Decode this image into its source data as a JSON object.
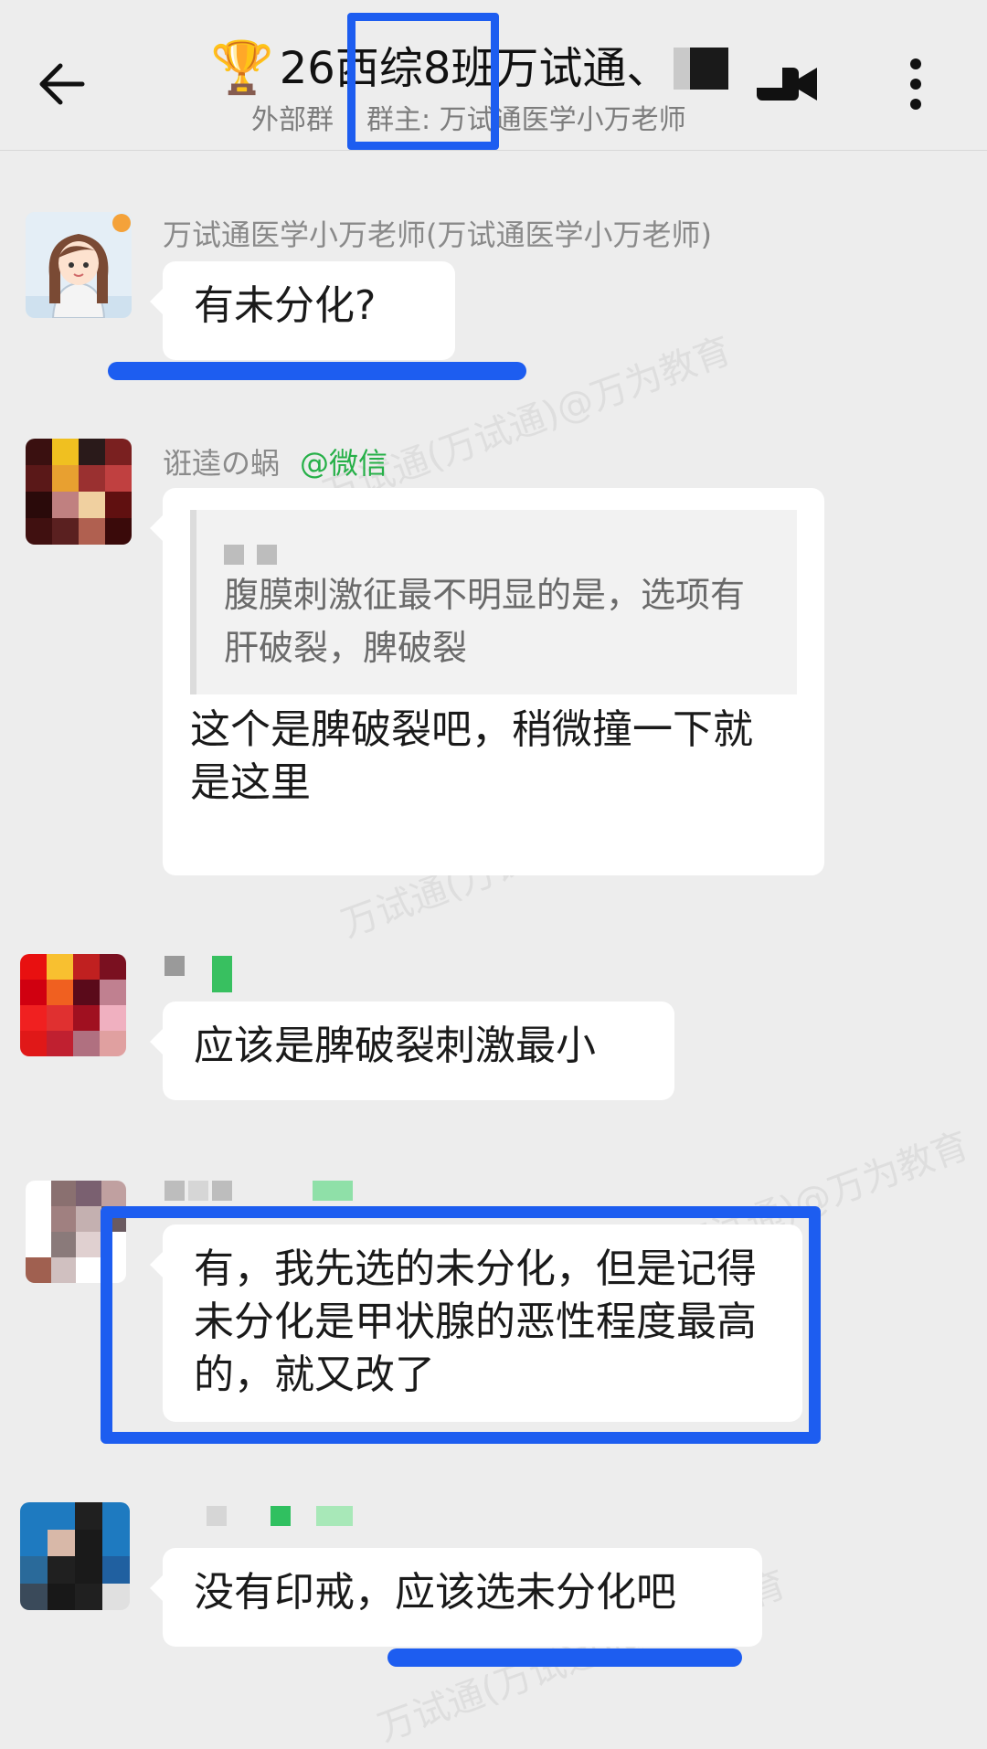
{
  "header": {
    "trophy_icon": "🏆",
    "title": "26西综8班万试通、",
    "subtitle_left": "外部群",
    "subtitle_right": "群主: 万试通医学小万老师"
  },
  "messages": [
    {
      "sender": "万试通医学小万老师(万试通医学小万老师)",
      "text": "有未分化?"
    },
    {
      "sender": "诳逵の蜗",
      "sender_tag": "@微信",
      "quote": "腹膜刺激征最不明显的是，选项有肝破裂，脾破裂",
      "text": "这个是脾破裂吧，稍微撞一下就是这里"
    },
    {
      "text": "应该是脾破裂刺激最小"
    },
    {
      "text": "有，我先选的未分化，但是记得未分化是甲状腺的恶性程度最高的，就又改了"
    },
    {
      "text": "没有印戒，应该选未分化吧"
    }
  ],
  "watermark": "万试通(万试通)@万为教育",
  "colors": {
    "highlight": "#1d5df0",
    "background": "#ededed",
    "bubble": "#ffffff",
    "wechat_tag": "#26b048"
  }
}
